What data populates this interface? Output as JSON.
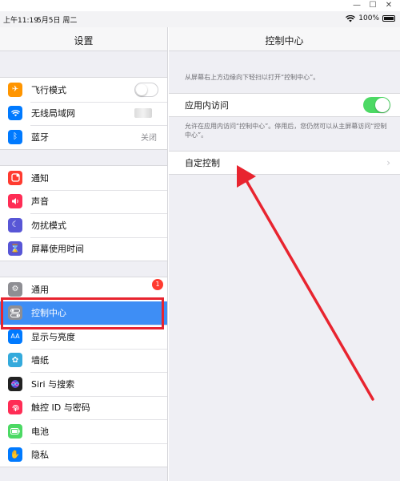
{
  "window": {
    "minimize": "—",
    "maximize": "☐",
    "close": "✕"
  },
  "statusbar": {
    "time": "上午11:19",
    "date": "5月5日 周二",
    "battery": "100%"
  },
  "left": {
    "title": "设置",
    "groups": [
      {
        "items": [
          {
            "label": "飞行模式",
            "icon": "airplane-icon",
            "color": "#ff9500"
          },
          {
            "label": "无线局域网",
            "icon": "wifi-icon",
            "color": "#007aff"
          },
          {
            "label": "蓝牙",
            "icon": "bluetooth-icon",
            "color": "#007aff",
            "value": "关闭"
          }
        ]
      },
      {
        "items": [
          {
            "label": "通知",
            "icon": "notifications-icon",
            "color": "#ff3b30"
          },
          {
            "label": "声音",
            "icon": "sound-icon",
            "color": "#ff2d55"
          },
          {
            "label": "勿扰模式",
            "icon": "moon-icon",
            "color": "#5856d6"
          },
          {
            "label": "屏幕使用时间",
            "icon": "hourglass-icon",
            "color": "#5856d6"
          }
        ]
      },
      {
        "items": [
          {
            "label": "通用",
            "icon": "gear-icon",
            "color": "#8e8e93",
            "badge": "1"
          },
          {
            "label": "控制中心",
            "icon": "toggles-icon",
            "color": "#8e8e93",
            "selected": true
          },
          {
            "label": "显示与亮度",
            "icon": "aa-icon",
            "color": "#007aff"
          },
          {
            "label": "墙纸",
            "icon": "flower-icon",
            "color": "#34aadc"
          },
          {
            "label": "Siri 与搜索",
            "icon": "siri-icon",
            "color": "#222222"
          },
          {
            "label": "触控 ID 与密码",
            "icon": "fingerprint-icon",
            "color": "#ff2d55"
          },
          {
            "label": "电池",
            "icon": "battery-icon",
            "color": "#4cd964"
          },
          {
            "label": "隐私",
            "icon": "hand-icon",
            "color": "#007aff"
          }
        ]
      }
    ]
  },
  "right": {
    "title": "控制中心",
    "hint": "从屏幕右上方边缘向下轻扫以打开“控制中心”。",
    "access_label": "应用内访问",
    "access_desc": "允许在应用内访问“控制中心”。停用后，您仍然可以从主屏幕访问“控制中心”。",
    "customize_label": "自定控制"
  },
  "annotation": {
    "color": "#e8242f"
  }
}
